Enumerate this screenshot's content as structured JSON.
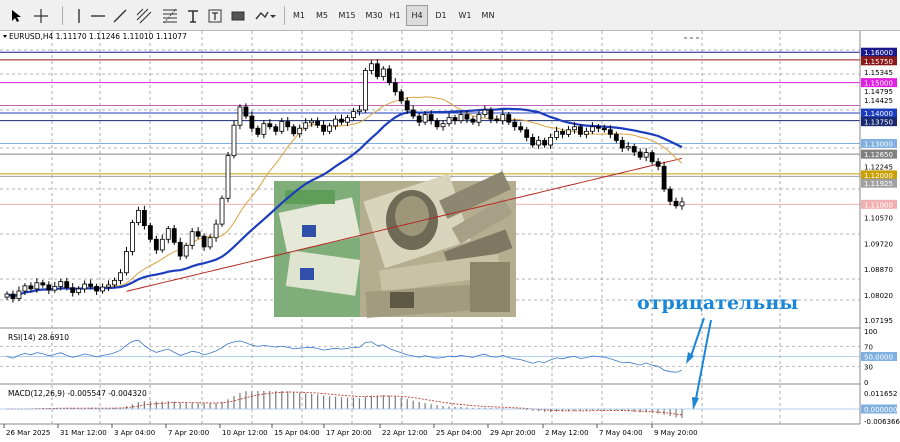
{
  "toolbar": {
    "timeframes": [
      "M1",
      "M5",
      "M15",
      "M30",
      "H1",
      "H4",
      "D1",
      "W1",
      "MN"
    ],
    "active_timeframe": "H4"
  },
  "colors": {
    "candle": "#000000",
    "ma_blue": "#1c3dbd",
    "ma_orange": "#d9a441",
    "ma_red": "#b3261e",
    "rsi_line": "#3c78c8",
    "macd_hist": "#7a7a7a",
    "macd_signal": "#c0392b",
    "overlay_text": "#1a86d6"
  },
  "chart_data": {
    "type": "candlestick",
    "title": "EURUSD,H4  1.11170 1.11246 1.11010 1.11077",
    "ylim": [
      1.07,
      1.165
    ],
    "yticks": [
      "1.16000",
      "1.15750",
      "1.15345",
      "1.15000",
      "1.14795",
      "1.14425",
      "1.14000",
      "1.13750",
      "1.13000",
      "1.12650",
      "1.12245",
      "1.12000",
      "1.11925",
      "1.11000",
      "1.10570",
      "1.09720",
      "1.08870",
      "1.08020",
      "1.07195"
    ],
    "xticks": [
      "26 Mar 2025",
      "31 Mar 12:00",
      "3 Apr 04:00",
      "7 Apr 20:00",
      "10 Apr 12:00",
      "15 Apr 04:00",
      "17 Apr 20:00",
      "22 Apr 12:00",
      "25 Apr 04:00",
      "29 Apr 20:00",
      "2 May 12:00",
      "7 May 04:00",
      "9 May 20:00"
    ],
    "level_lines": [
      {
        "price": 1.16,
        "label": "1.16000",
        "color": "#1a1a8c"
      },
      {
        "price": 1.1575,
        "label": "1.15750",
        "color": "#8b1a1a"
      },
      {
        "price": 1.15,
        "label": "1.15000",
        "color": "#e020e0"
      },
      {
        "price": 1.1425,
        "label": "1.14250",
        "color": "#c060c0"
      },
      {
        "price": 1.14,
        "label": "1.14000",
        "color": "#1c3dbd"
      },
      {
        "price": 1.1375,
        "label": "1.13750",
        "color": "#1a2a70"
      },
      {
        "price": 1.13,
        "label": "1.13000",
        "color": "#7fb0e0"
      },
      {
        "price": 1.1265,
        "label": "1.12650",
        "color": "#808080"
      },
      {
        "price": 1.12,
        "label": "1.12000",
        "color": "#c8a000"
      },
      {
        "price": 1.1192,
        "label": "1.11925",
        "color": "#a0a0a0"
      },
      {
        "price": 1.11,
        "label": "1.11000",
        "color": "#f0b0b0"
      }
    ],
    "close": [
      1.0805,
      1.079,
      1.0815,
      1.0832,
      1.0822,
      1.0842,
      1.0835,
      1.0818,
      1.083,
      1.0846,
      1.0826,
      1.081,
      1.0822,
      1.0838,
      1.083,
      1.0815,
      1.0828,
      1.0835,
      1.085,
      1.0875,
      1.0945,
      1.104,
      1.108,
      1.103,
      1.0985,
      1.095,
      1.0985,
      1.102,
      1.0975,
      1.093,
      1.0965,
      1.101,
      1.0995,
      1.096,
      1.099,
      1.1035,
      1.112,
      1.126,
      1.136,
      1.142,
      1.139,
      1.135,
      1.133,
      1.1365,
      1.1355,
      1.134,
      1.1372,
      1.1355,
      1.1332,
      1.135,
      1.1368,
      1.1374,
      1.136,
      1.134,
      1.1358,
      1.138,
      1.137,
      1.1385,
      1.1405,
      1.141,
      1.154,
      1.1562,
      1.152,
      1.1545,
      1.15,
      1.147,
      1.144,
      1.141,
      1.139,
      1.137,
      1.1395,
      1.1375,
      1.1355,
      1.1365,
      1.1385,
      1.1375,
      1.1395,
      1.138,
      1.137,
      1.1395,
      1.141,
      1.138,
      1.1375,
      1.1395,
      1.137,
      1.1355,
      1.1345,
      1.132,
      1.1295,
      1.131,
      1.1295,
      1.132,
      1.134,
      1.133,
      1.1345,
      1.1355,
      1.133,
      1.134,
      1.1355,
      1.135,
      1.1345,
      1.133,
      1.131,
      1.1285,
      1.129,
      1.1272,
      1.1255,
      1.127,
      1.124,
      1.1225,
      1.115,
      1.111,
      1.1095,
      1.1108
    ],
    "rsi": {
      "label": "RSI(14) 28.6910",
      "levels": [
        100,
        70,
        50,
        30,
        0
      ],
      "level_labels": [
        "100",
        "70",
        "50.0000",
        "30",
        "0"
      ]
    },
    "macd": {
      "label": "MACD(12,26,9) -0.005547 -0.004320",
      "yticks": [
        "0.011652",
        "0.000000",
        "-0.006366"
      ]
    }
  },
  "annotation": {
    "text": "отрицательны"
  }
}
